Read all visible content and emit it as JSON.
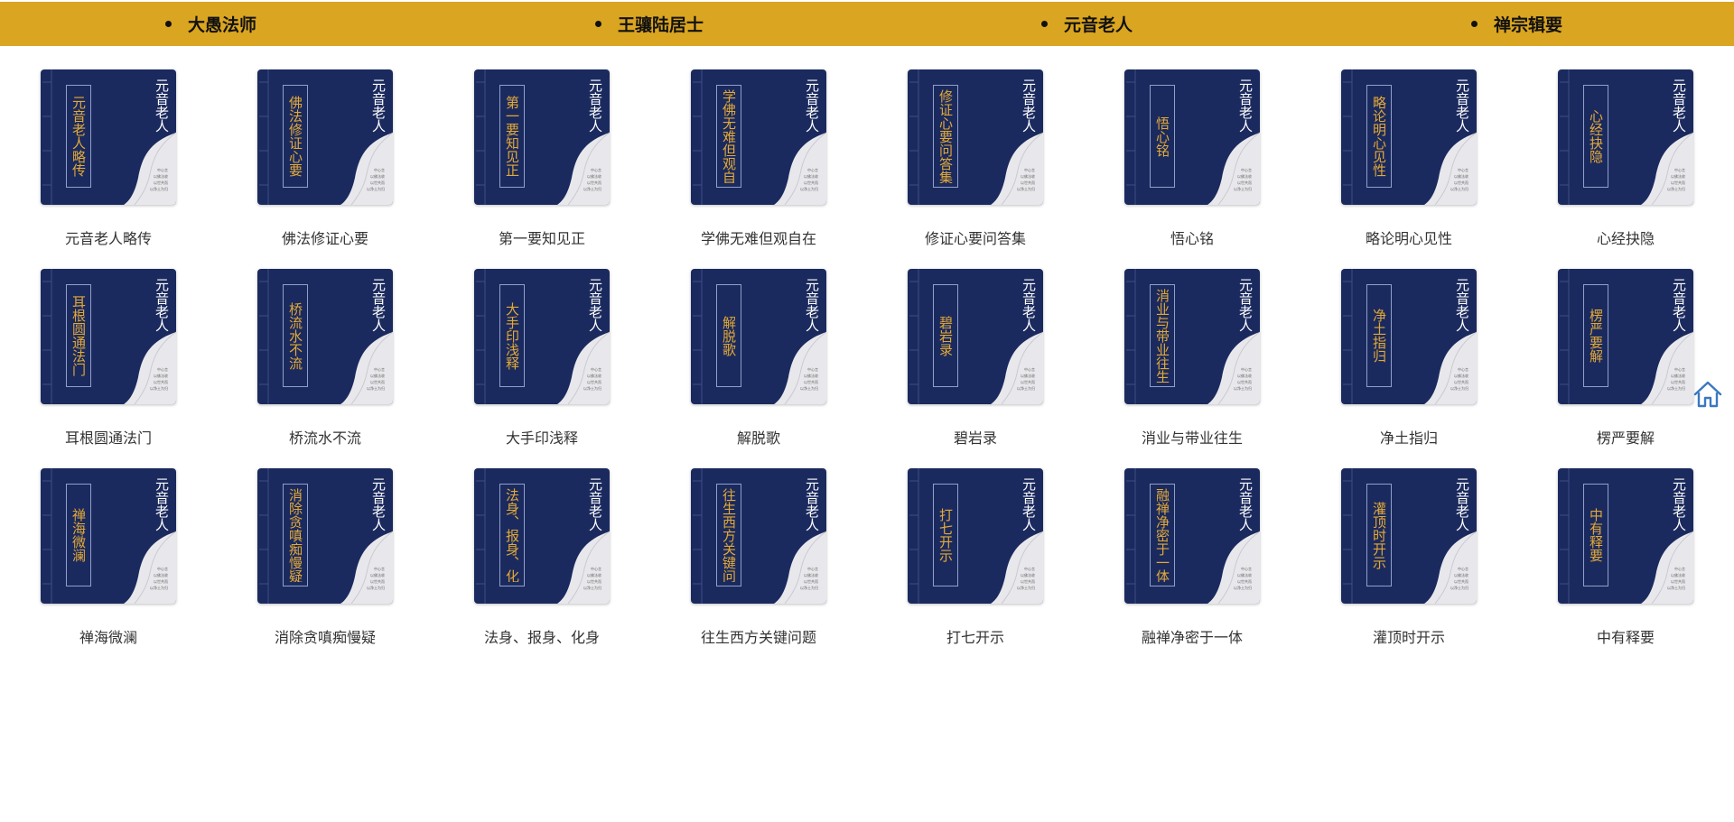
{
  "nav": {
    "items": [
      {
        "label": "大愚法师"
      },
      {
        "label": "王骧陆居士"
      },
      {
        "label": "元音老人"
      },
      {
        "label": "禅宗辑要"
      }
    ]
  },
  "cover_fine_print": [
    "中心言",
    "以佛法收",
    "以世共而",
    "以净土为归"
  ],
  "books": [
    {
      "title": "元音老人略传",
      "cover_title": "元音老人略传",
      "author": "元音老人"
    },
    {
      "title": "佛法修证心要",
      "cover_title": "佛法修证心要",
      "author": "元音老人"
    },
    {
      "title": "第一要知见正",
      "cover_title": "第一要知见正",
      "author": "元音老人"
    },
    {
      "title": "学佛无难但观自在",
      "cover_title": "学佛无难但观自在",
      "author": "元音老人"
    },
    {
      "title": "修证心要问答集",
      "cover_title": "修证心要问答集",
      "author": "元音老人"
    },
    {
      "title": "悟心铭",
      "cover_title": "悟心铭",
      "author": "元音老人"
    },
    {
      "title": "略论明心见性",
      "cover_title": "略论明心见性",
      "author": "元音老人"
    },
    {
      "title": "心经抉隐",
      "cover_title": "心经抉隐",
      "author": "元音老人"
    },
    {
      "title": "耳根圆通法门",
      "cover_title": "耳根圆通法门",
      "author": "元音老人"
    },
    {
      "title": "桥流水不流",
      "cover_title": "桥流水不流",
      "author": "元音老人"
    },
    {
      "title": "大手印浅释",
      "cover_title": "大手印浅释",
      "author": "元音老人"
    },
    {
      "title": "解脱歌",
      "cover_title": "解脱歌",
      "author": "元音老人"
    },
    {
      "title": "碧岩录",
      "cover_title": "碧岩录",
      "author": "元音老人"
    },
    {
      "title": "消业与带业往生",
      "cover_title": "消业与带业往生",
      "author": "元音老人"
    },
    {
      "title": "净土指归",
      "cover_title": "净土指归",
      "author": "元音老人"
    },
    {
      "title": "楞严要解",
      "cover_title": "楞严要解",
      "author": "元音老人"
    },
    {
      "title": "禅海微澜",
      "cover_title": "禅海微澜",
      "author": "元音老人"
    },
    {
      "title": "消除贪嗔痴慢疑",
      "cover_title": "消除贪嗔痴慢疑",
      "author": "元音老人"
    },
    {
      "title": "法身、报身、化身",
      "cover_title": "法身、报身、化身",
      "author": "元音老人"
    },
    {
      "title": "往生西方关键问题",
      "cover_title": "往生西方关键问题",
      "author": "元音老人"
    },
    {
      "title": "打七开示",
      "cover_title": "打七开示",
      "author": "元音老人"
    },
    {
      "title": "融禅净密于一体",
      "cover_title": "融禅净密于一体",
      "author": "元音老人"
    },
    {
      "title": "灌顶时开示",
      "cover_title": "灌顶时开示",
      "author": "元音老人"
    },
    {
      "title": "中有释要",
      "cover_title": "中有释要",
      "author": "元音老人"
    }
  ],
  "colors": {
    "nav_bg": "#DAA520",
    "cover_bg": "#1B2A5E",
    "cover_title": "#E3A937",
    "page_curl": "#E8E8EC"
  },
  "icons": {
    "back_to_home": "home-icon"
  }
}
